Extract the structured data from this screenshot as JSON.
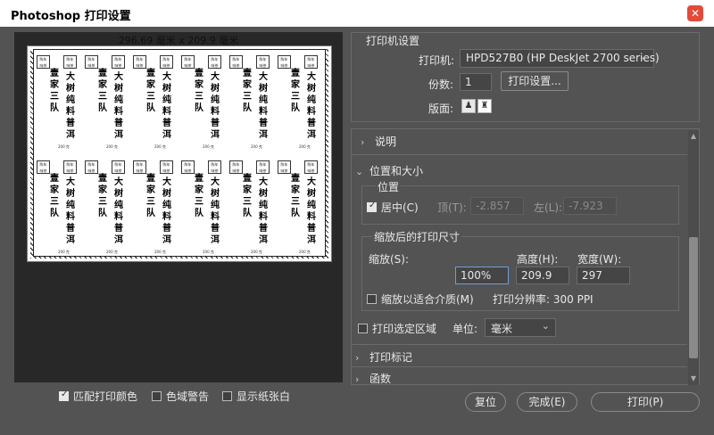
{
  "window": {
    "title": "Photoshop 打印设置",
    "close_glyph": "✕"
  },
  "preview": {
    "dimensions": "296.69 毫米 x 209.9 毫米",
    "labels": {
      "stamp_text": "陈年\n味茶",
      "line1": "壹家三队",
      "line2": "大树纯料普洱",
      "small": "200 克"
    }
  },
  "bottom_checks": [
    {
      "label": "匹配打印颜色",
      "checked": true
    },
    {
      "label": "色域警告",
      "checked": false
    },
    {
      "label": "显示纸张白",
      "checked": false
    }
  ],
  "printer_setup": {
    "group_title": "打印机设置",
    "printer_label": "打印机:",
    "printer_value": "HPD527B0 (HP DeskJet 2700 series)",
    "copies_label": "份数:",
    "copies_value": "1",
    "settings_button": "打印设置...",
    "layout_label": "版面:"
  },
  "sections": {
    "description": "说明",
    "position_size": "位置和大小",
    "print_marks": "打印标记",
    "functions": "函数"
  },
  "position": {
    "group_title": "位置",
    "center_label": "居中(C)",
    "center_checked": true,
    "top_label": "顶(T):",
    "top_value": "-2.857",
    "left_label": "左(L):",
    "left_value": "-7.923"
  },
  "scaled": {
    "group_title": "缩放后的打印尺寸",
    "scale_label": "缩放(S):",
    "scale_value": "100%",
    "height_label": "高度(H):",
    "height_value": "209.9",
    "width_label": "宽度(W):",
    "width_value": "297",
    "fit_label": "缩放以适合介质(M)",
    "fit_checked": false,
    "resolution": "打印分辨率: 300 PPI"
  },
  "selection": {
    "label": "打印选定区域",
    "checked": false,
    "unit_label": "单位:",
    "unit_value": "毫米"
  },
  "buttons": {
    "reset": "复位",
    "done": "完成(E)",
    "print": "打印(P)"
  }
}
